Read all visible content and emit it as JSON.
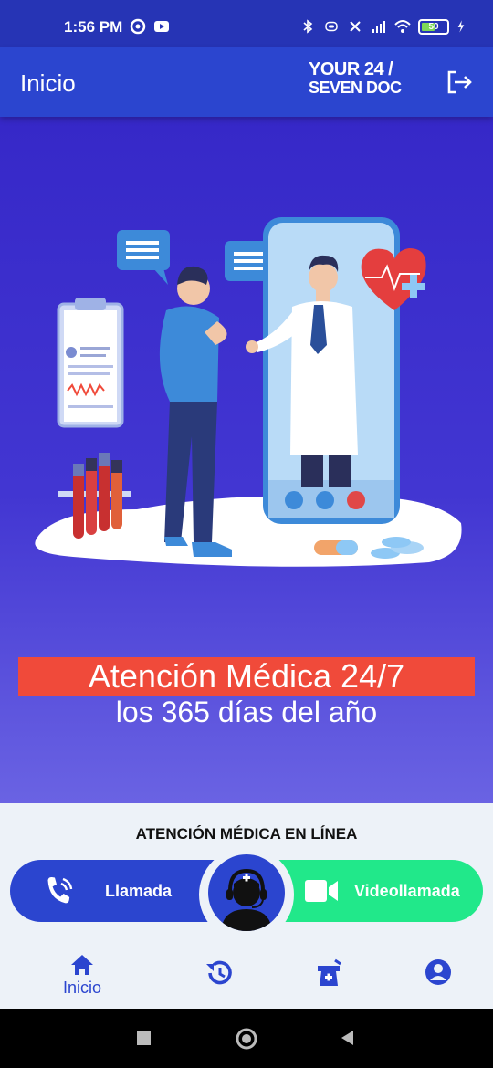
{
  "status_bar": {
    "time": "1:56 PM",
    "battery": "50"
  },
  "app_bar": {
    "title": "Inicio",
    "logo_line1": "YOUR 24 /",
    "logo_line2": "SEVEN DOC"
  },
  "hero": {
    "banner_text": "Atención Médica 24/7",
    "subtitle": "los 365 días del año"
  },
  "online_care": {
    "heading": "ATENCIÓN MÉDICA EN LÍNEA",
    "call_label": "Llamada",
    "video_label": "Videollamada"
  },
  "tabs": [
    {
      "label": "Inicio",
      "icon": "home-icon"
    },
    {
      "label": "",
      "icon": "history-icon"
    },
    {
      "label": "",
      "icon": "pharmacy-icon"
    },
    {
      "label": "",
      "icon": "profile-icon"
    }
  ],
  "colors": {
    "primary": "#2b45cf",
    "accent_green": "#21e88a",
    "banner_red": "#f04a3a"
  }
}
